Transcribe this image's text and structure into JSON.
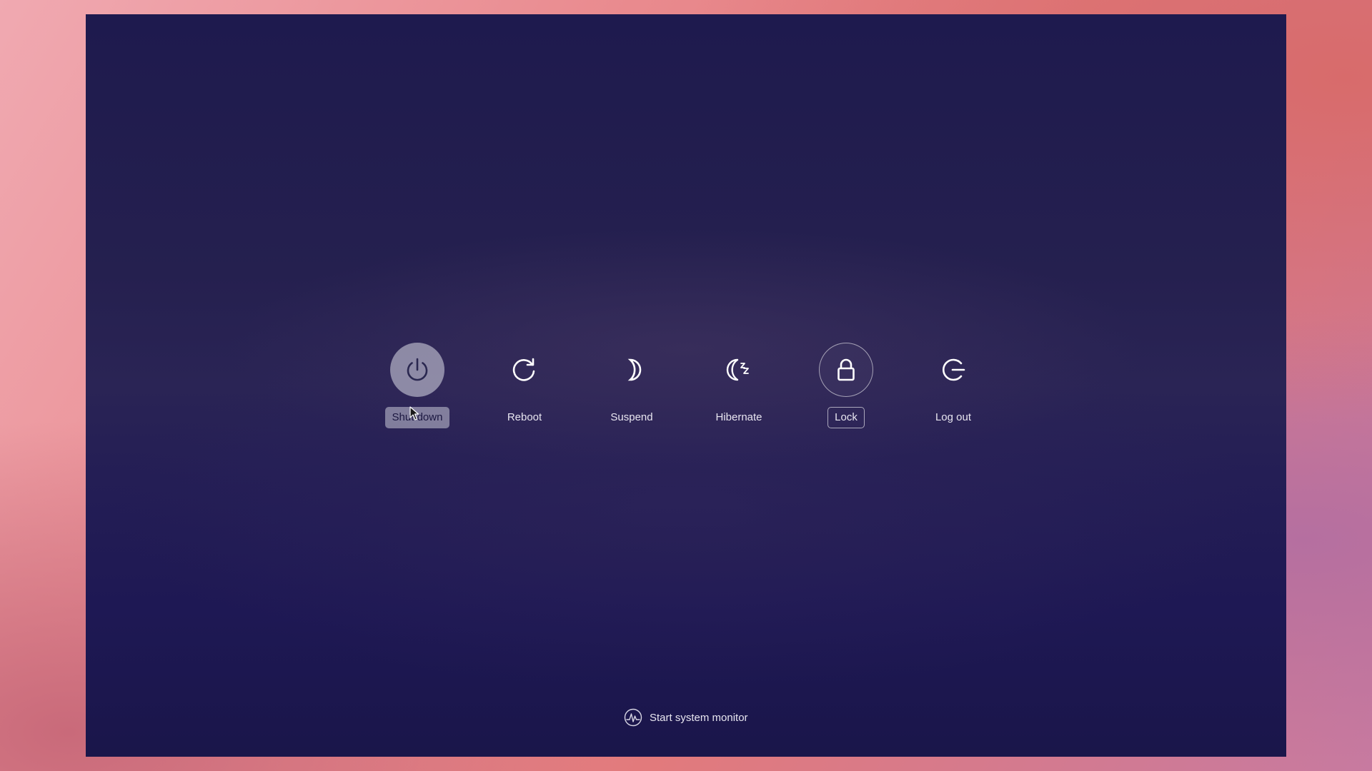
{
  "actions": [
    {
      "id": "shutdown",
      "label": "Shut down",
      "icon": "power-icon",
      "state": "hovered"
    },
    {
      "id": "reboot",
      "label": "Reboot",
      "icon": "reboot-icon",
      "state": "normal"
    },
    {
      "id": "suspend",
      "label": "Suspend",
      "icon": "moon-icon",
      "state": "normal"
    },
    {
      "id": "hibernate",
      "label": "Hibernate",
      "icon": "hibernate-icon",
      "state": "normal"
    },
    {
      "id": "lock",
      "label": "Lock",
      "icon": "lock-icon",
      "state": "focused"
    },
    {
      "id": "logout",
      "label": "Log out",
      "icon": "logout-icon",
      "state": "normal"
    }
  ],
  "monitor": {
    "label": "Start system monitor",
    "icon": "system-monitor-icon"
  },
  "colors": {
    "panel_background": "#221d52",
    "text": "#e8e6f0",
    "hover_highlight": "#c8c8d7"
  }
}
